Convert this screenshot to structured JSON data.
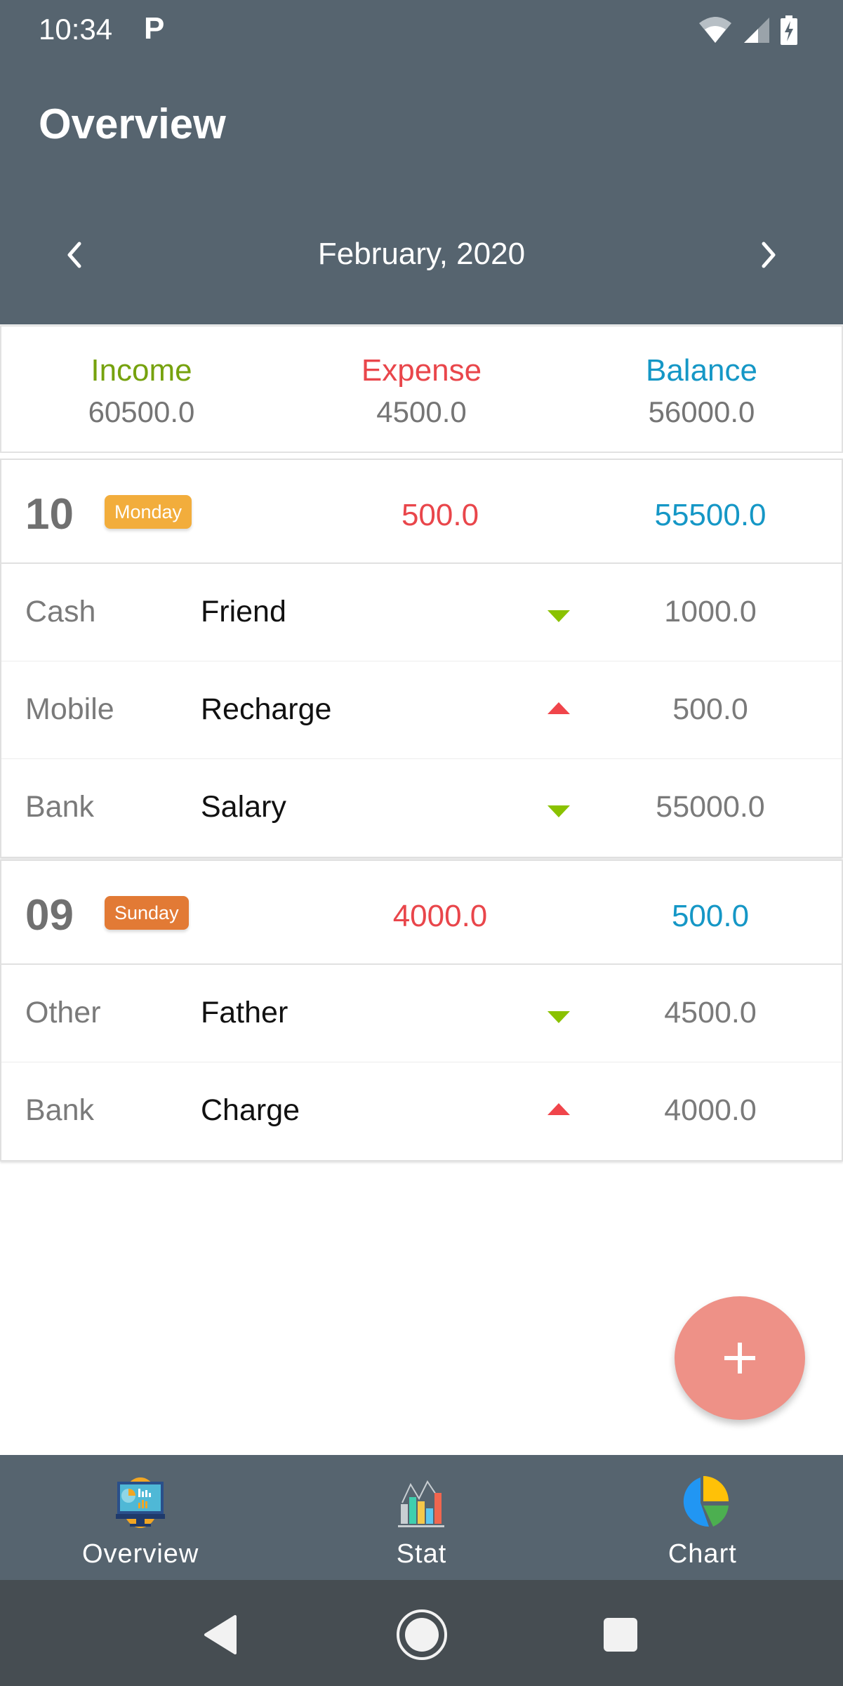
{
  "status_bar": {
    "time": "10:34",
    "notification_icon": "parking-p-icon",
    "icons": [
      "wifi-icon",
      "cell-signal-icon",
      "battery-charging-icon"
    ]
  },
  "header": {
    "title": "Overview",
    "month": "February, 2020",
    "prev_icon": "chevron-left-icon",
    "next_icon": "chevron-right-icon"
  },
  "summary": {
    "income": {
      "label": "Income",
      "value": "60500.0",
      "color": "#76a20e"
    },
    "expense": {
      "label": "Expense",
      "value": "4500.0",
      "color": "#e9464b"
    },
    "balance": {
      "label": "Balance",
      "value": "56000.0",
      "color": "#1597c6"
    }
  },
  "days": [
    {
      "day": "10",
      "weekday": "Monday",
      "badge_color": "#f2ad3c",
      "expense": "500.0",
      "balance": "55500.0",
      "transactions": [
        {
          "account": "Cash",
          "category": "Friend",
          "direction": "income",
          "amount": "1000.0"
        },
        {
          "account": "Mobile",
          "category": "Recharge",
          "direction": "expense",
          "amount": "500.0"
        },
        {
          "account": "Bank",
          "category": "Salary",
          "direction": "income",
          "amount": "55000.0"
        }
      ]
    },
    {
      "day": "09",
      "weekday": "Sunday",
      "badge_color": "#e27a35",
      "expense": "4000.0",
      "balance": "500.0",
      "transactions": [
        {
          "account": "Other",
          "category": "Father",
          "direction": "income",
          "amount": "4500.0"
        },
        {
          "account": "Bank",
          "category": "Charge",
          "direction": "expense",
          "amount": "4000.0"
        }
      ]
    }
  ],
  "fab": {
    "icon": "plus-icon",
    "color": "#ee9187"
  },
  "bottom_nav": {
    "items": [
      {
        "label": "Overview",
        "icon": "monitor-dashboard-icon"
      },
      {
        "label": "Stat",
        "icon": "bar-chart-icon"
      },
      {
        "label": "Chart",
        "icon": "pie-chart-icon"
      }
    ]
  },
  "system_nav": {
    "back": "back-icon",
    "home": "home-icon",
    "recents": "recents-icon"
  }
}
